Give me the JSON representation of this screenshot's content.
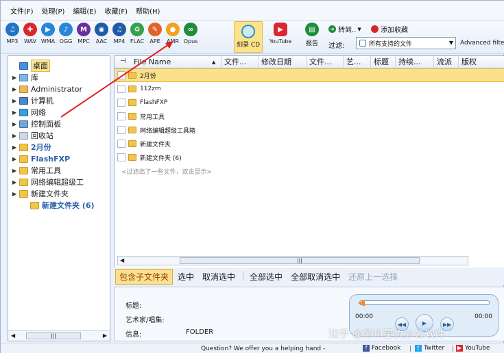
{
  "menu": [
    "文件(F)",
    "处理(P)",
    "编辑(E)",
    "收藏(F)",
    "帮助(H)"
  ],
  "toolbar": {
    "formats": [
      {
        "label": "MP3",
        "color": "#1f73c9",
        "glyph": "♫"
      },
      {
        "label": "WAV",
        "color": "#d9272f",
        "glyph": "✚"
      },
      {
        "label": "WMA",
        "color": "#2a86d6",
        "glyph": "▶"
      },
      {
        "label": "OGG",
        "color": "#2a86d6",
        "glyph": "♪"
      },
      {
        "label": "MPC",
        "color": "#6a2fa0",
        "glyph": "M"
      },
      {
        "label": "AAC",
        "color": "#1f5aa8",
        "glyph": "◉"
      },
      {
        "label": "MP4",
        "color": "#1f5aa8",
        "glyph": "♫"
      },
      {
        "label": "FLAC",
        "color": "#37a04a",
        "glyph": "♻"
      },
      {
        "label": "APE",
        "color": "#e2632a",
        "glyph": "✎"
      },
      {
        "label": "AMR",
        "color": "#f2a21f",
        "glyph": "●"
      },
      {
        "label": "Opus",
        "color": "#1f8c3b",
        "glyph": "∞"
      }
    ],
    "burn_label": "刻录 CD",
    "youtube_label": "YouTube",
    "report_label": "报告",
    "convert_label": "转到..",
    "favorite_label": "添加收藏",
    "filter_label": "过滤:",
    "filter_value": "所有支持的文件",
    "advanced_filter": "Advanced filter"
  },
  "sidebar": {
    "items": [
      {
        "label": "桌面",
        "icon": "desktop-icon",
        "expander": ""
      },
      {
        "label": "库",
        "icon": "library-icon",
        "expander": "▶"
      },
      {
        "label": "Administrator",
        "icon": "user-folder-icon",
        "expander": "▶"
      },
      {
        "label": "计算机",
        "icon": "computer-icon",
        "expander": "▶"
      },
      {
        "label": "网络",
        "icon": "network-icon",
        "expander": "▶"
      },
      {
        "label": "控制面板",
        "icon": "control-panel-icon",
        "expander": "▶"
      },
      {
        "label": "回收站",
        "icon": "recycle-bin-icon",
        "expander": "▶"
      },
      {
        "label": "2月份",
        "icon": "folder-icon",
        "expander": "▶"
      },
      {
        "label": "FlashFXP",
        "icon": "folder-icon",
        "expander": "▶"
      },
      {
        "label": "常用工具",
        "icon": "folder-icon",
        "expander": "▶"
      },
      {
        "label": "网络编辑超级工",
        "icon": "folder-icon",
        "expander": "▶"
      },
      {
        "label": "新建文件夹",
        "icon": "folder-icon",
        "expander": "▶"
      },
      {
        "label": "新建文件夹 (6)",
        "icon": "folder-icon",
        "expander": ""
      }
    ],
    "scroll_thumb": "|||"
  },
  "filelist": {
    "columns": [
      "File Name",
      "文件...",
      "修改日期",
      "文件...",
      "艺...",
      "标题",
      "持续...",
      "流派",
      "版权"
    ],
    "rows": [
      "2月份",
      "112zm",
      "FlashFXP",
      "常用工具",
      "网络编辑超级工具箱",
      "新建文件夹",
      "新建文件夹 (6)"
    ],
    "filtered_note": "<过滤出了一些文件，双击显示>",
    "scroll_thumb": "|||"
  },
  "selectbar": {
    "include_subfolders": "包含子文件夹",
    "select": "选中",
    "deselect": "取消选中",
    "select_all": "全部选中",
    "deselect_all": "全部取消选中",
    "restore": "还原上一选择"
  },
  "info": {
    "title_label": "标题:",
    "artist_label": "艺术家/唱集:",
    "info_label": "信息:",
    "info_value": "FOLDER"
  },
  "player": {
    "time_start": "00:00",
    "time_end": "00:00"
  },
  "watermark": "知乎 @苏州星优办公软件",
  "status": {
    "question": "Question? We offer you a helping hand -",
    "facebook": "Facebook",
    "twitter": "Twitter",
    "youtube": "YouTube"
  }
}
